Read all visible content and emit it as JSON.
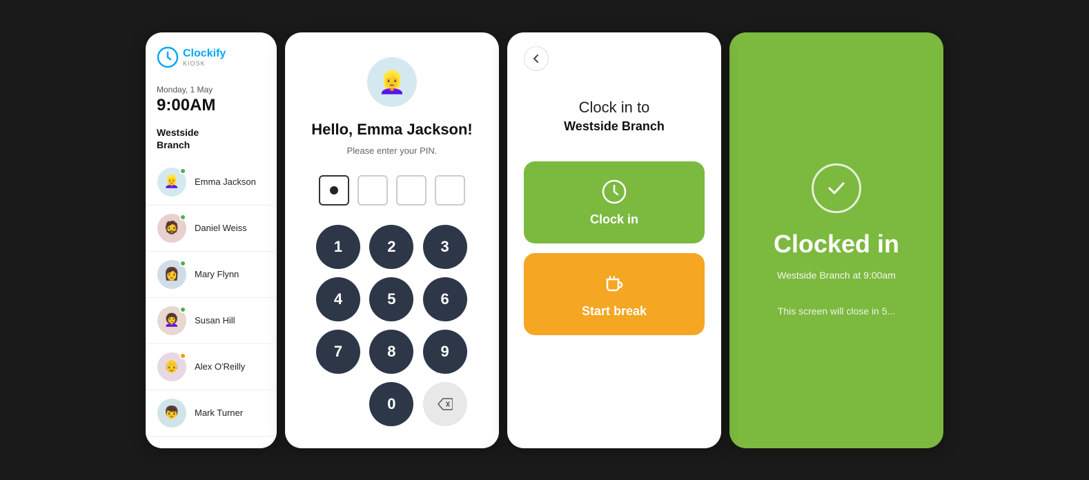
{
  "kiosk": {
    "logo_name": "Clockify",
    "logo_sub": "KIOSK",
    "date": "Monday, 1 May",
    "time": "9:00AM",
    "branch": "Westside\nBranch",
    "branch_label": "Westside Branch"
  },
  "users": [
    {
      "id": "emma",
      "name": "Emma Jackson",
      "status": "green",
      "emoji": "👱‍♀️",
      "bg": "av-emma"
    },
    {
      "id": "daniel",
      "name": "Daniel Weiss",
      "status": "green",
      "emoji": "🧔",
      "bg": "av-daniel"
    },
    {
      "id": "mary",
      "name": "Mary Flynn",
      "status": "green",
      "emoji": "👩",
      "bg": "av-mary"
    },
    {
      "id": "susan",
      "name": "Susan Hill",
      "status": "green",
      "emoji": "👩‍🦱",
      "bg": "av-susan"
    },
    {
      "id": "alex",
      "name": "Alex O'Reilly",
      "status": "orange",
      "emoji": "👴",
      "bg": "av-alex"
    },
    {
      "id": "mark",
      "name": "Mark Turner",
      "status": "",
      "emoji": "👦",
      "bg": "av-mark"
    }
  ],
  "pin_screen": {
    "hello": "Hello, Emma Jackson!",
    "prompt": "Please enter your PIN.",
    "avatar_emoji": "👱‍♀️",
    "filled_count": 1,
    "total_dots": 4,
    "buttons": [
      "1",
      "2",
      "3",
      "4",
      "5",
      "6",
      "7",
      "8",
      "9",
      "0",
      "⌫"
    ]
  },
  "action_screen": {
    "title": "Clock in to",
    "subtitle": "Westside Branch",
    "clock_in_label": "Clock in",
    "break_label": "Start break"
  },
  "clocked_screen": {
    "title": "Clocked in",
    "subtitle": "Westside Branch at 9:00am",
    "closing": "This screen will close in 5..."
  }
}
